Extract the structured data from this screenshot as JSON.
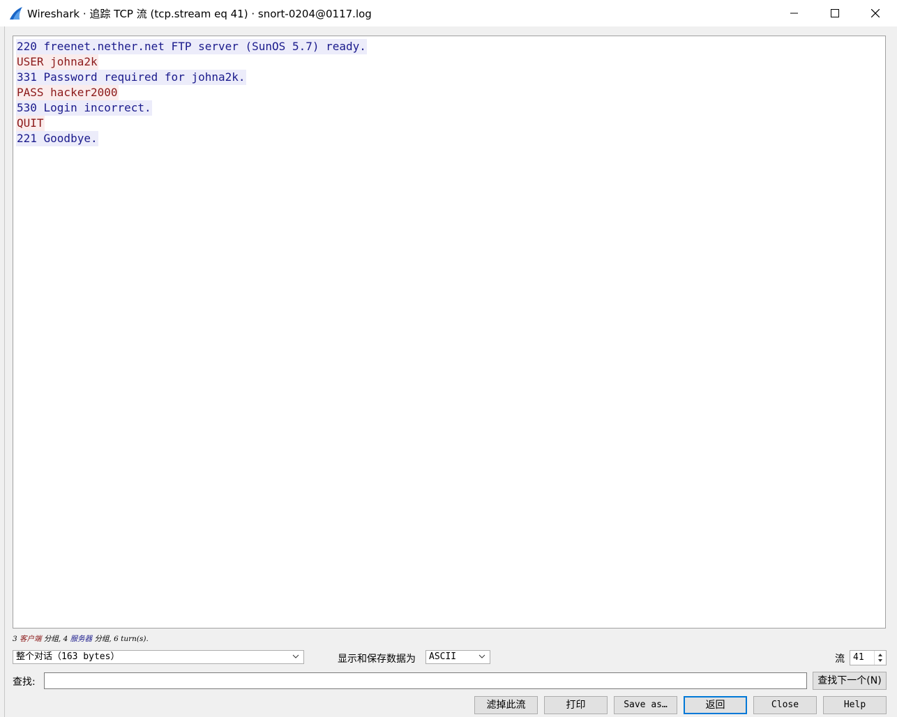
{
  "window": {
    "title": "Wireshark · 追踪 TCP 流 (tcp.stream eq 41) · snort-0204@0117.log"
  },
  "stream": {
    "lines": [
      {
        "who": "server",
        "text": "220 freenet.nether.net FTP server (SunOS 5.7) ready."
      },
      {
        "who": "client",
        "text": "USER johna2k"
      },
      {
        "who": "server",
        "text": "331 Password required for johna2k."
      },
      {
        "who": "client",
        "text": "PASS hacker2000"
      },
      {
        "who": "server",
        "text": "530 Login incorrect."
      },
      {
        "who": "client",
        "text": "QUIT"
      },
      {
        "who": "server",
        "text": "221 Goodbye."
      }
    ],
    "client_color": "#8c1a1a",
    "server_color": "#1a1a8c"
  },
  "summary": {
    "client_count": "3",
    "client_label": "客户端",
    "mid": "分组,",
    "server_count": "4",
    "server_label": "服务器",
    "tail": "分组, 6 turn(s)."
  },
  "controls": {
    "conversation_select": "整个对话（163 bytes）",
    "format_label": "显示和保存数据为",
    "format_select": "ASCII",
    "stream_label": "流",
    "stream_value": "41",
    "find_label": "查找:",
    "find_value": "",
    "find_next": "查找下一个(N)"
  },
  "buttons": {
    "filter_out": "滤掉此流",
    "print": "打印",
    "save_as": "Save as…",
    "back": "返回",
    "close": "Close",
    "help": "Help"
  },
  "icons": {
    "app": "wireshark-fin-icon",
    "minimize": "minimize-icon",
    "maximize": "maximize-icon",
    "close": "close-icon",
    "dropdown": "chevron-down-icon",
    "spinner": "spinner-arrows-icon"
  }
}
